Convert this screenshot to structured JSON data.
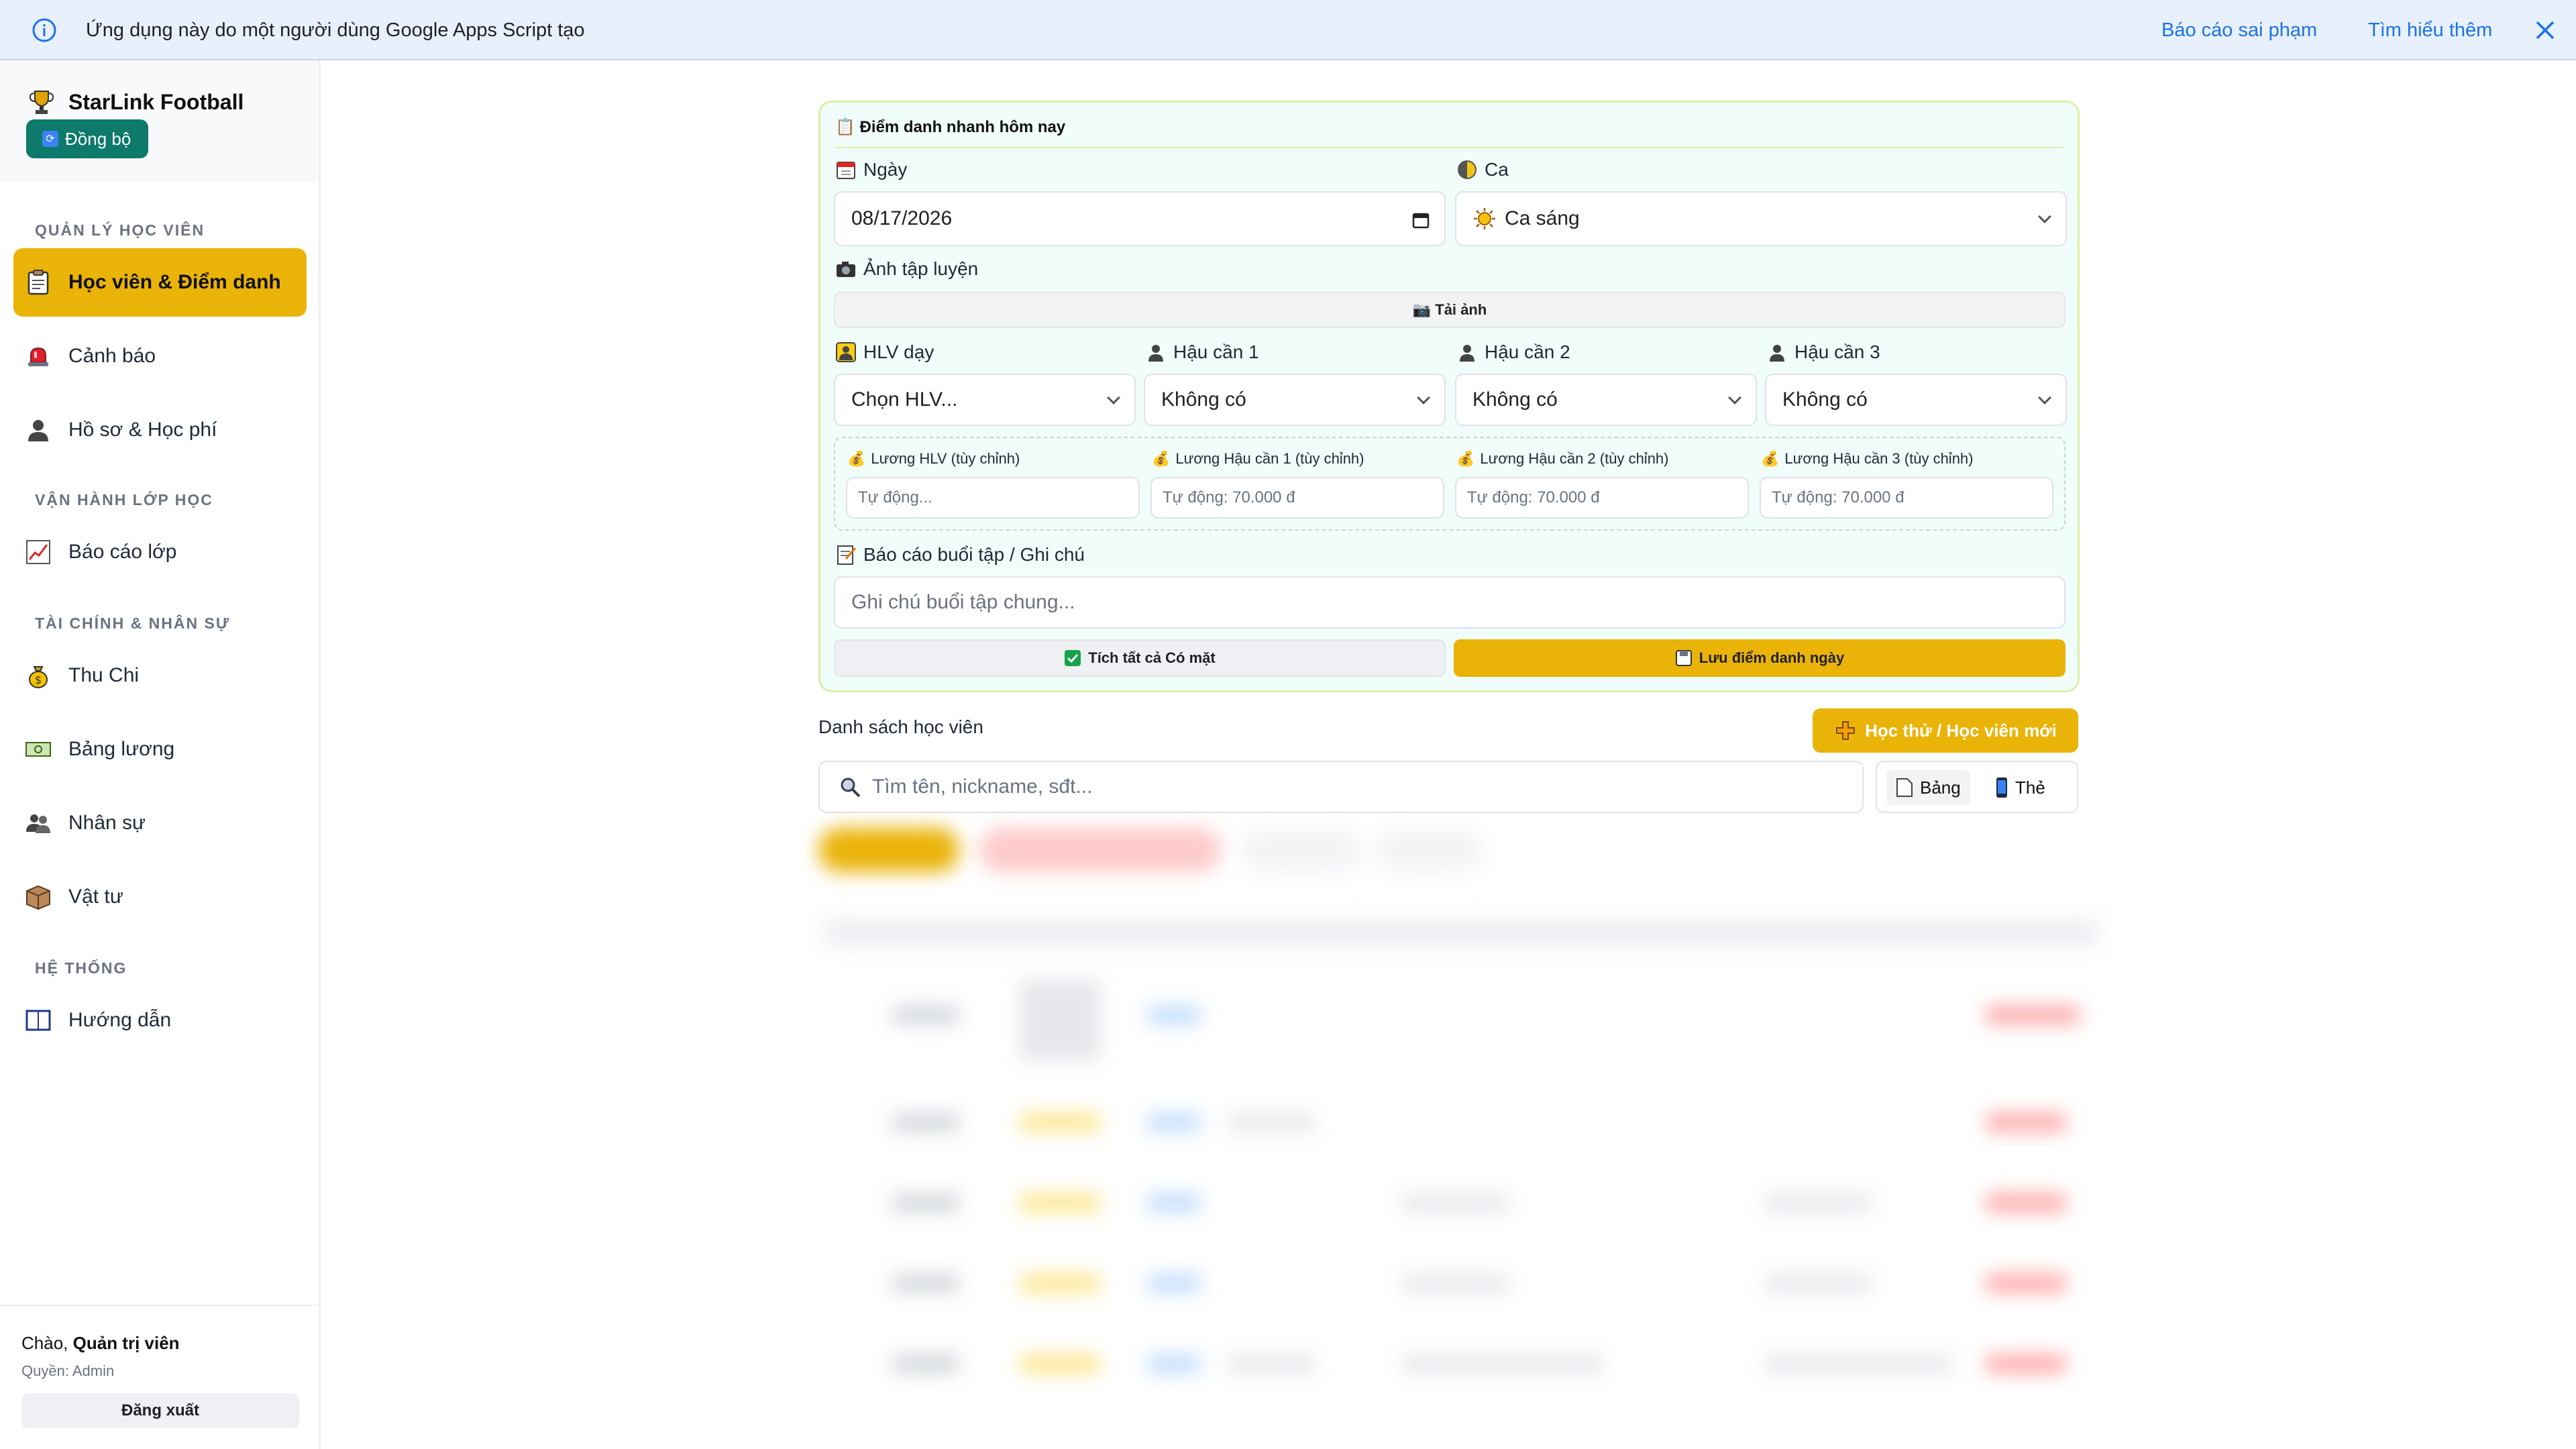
{
  "banner": {
    "message": "Ứng dụng này do một người dùng Google Apps Script tạo",
    "report_link": "Báo cáo sai phạm",
    "learn_more_link": "Tìm hiểu thêm"
  },
  "sidebar": {
    "brand": "StarLink Football",
    "sync_label": "Đồng bộ",
    "sections": {
      "students": "QUẢN LÝ HỌC VIÊN",
      "classes": "VẬN HÀNH LỚP HỌC",
      "finance": "TÀI CHÍNH & NHÂN SỰ",
      "system": "HỆ THỐNG"
    },
    "items": [
      {
        "label": "Học viên & Điểm danh"
      },
      {
        "label": "Cảnh báo"
      },
      {
        "label": "Hồ sơ & Học phí"
      },
      {
        "label": "Báo cáo lớp"
      },
      {
        "label": "Thu Chi"
      },
      {
        "label": "Bảng lương"
      },
      {
        "label": "Nhân sự"
      },
      {
        "label": "Vật tư"
      },
      {
        "label": "Hướng dẫn"
      }
    ],
    "user": {
      "greeting": "Chào,",
      "name": "Quản trị viên",
      "role": "Quyền: Admin",
      "logout": "Đăng xuất"
    }
  },
  "attendance": {
    "title": "Điểm danh nhanh hôm nay",
    "date_label": "Ngày",
    "date_value": "08/17/2026",
    "shift_label": "Ca",
    "shift_value": "Ca sáng",
    "photo_label": "Ảnh tập luyện",
    "upload_label": "Tải ảnh",
    "coach_label": "HLV dạy",
    "coach_value": "Chọn HLV...",
    "logistics1_label": "Hậu cần 1",
    "logistics1_value": "Không có",
    "logistics2_label": "Hậu cần 2",
    "logistics2_value": "Không có",
    "logistics3_label": "Hậu cần 3",
    "logistics3_value": "Không có",
    "salary": {
      "coach_label": "Lương HLV (tùy chỉnh)",
      "coach_placeholder": "Tự động...",
      "l1_label": "Lương Hậu cần 1 (tùy chỉnh)",
      "l1_placeholder": "Tự động: 70.000 đ",
      "l2_label": "Lương Hậu cần 2 (tùy chỉnh)",
      "l2_placeholder": "Tự động: 70.000 đ",
      "l3_label": "Lương Hậu cần 3 (tùy chỉnh)",
      "l3_placeholder": "Tự động: 70.000 đ"
    },
    "report_label": "Báo cáo buổi tập / Ghi chú",
    "report_placeholder": "Ghi chú buổi tập chung...",
    "check_all": "Tích tất cả Có mặt",
    "save": "Lưu điểm danh ngày"
  },
  "list": {
    "title": "Danh sách học viên",
    "new_button": "Học thử / Học viên mới",
    "search_placeholder": "Tìm tên, nickname, sđt...",
    "view_table": "Bảng",
    "view_card": "Thẻ"
  },
  "colors": {
    "accent": "#eab308",
    "teal": "#0d7a6b",
    "link": "#1a73e8",
    "banner_bg": "#e8f0fe",
    "card_bg": "#f0fdfa"
  }
}
